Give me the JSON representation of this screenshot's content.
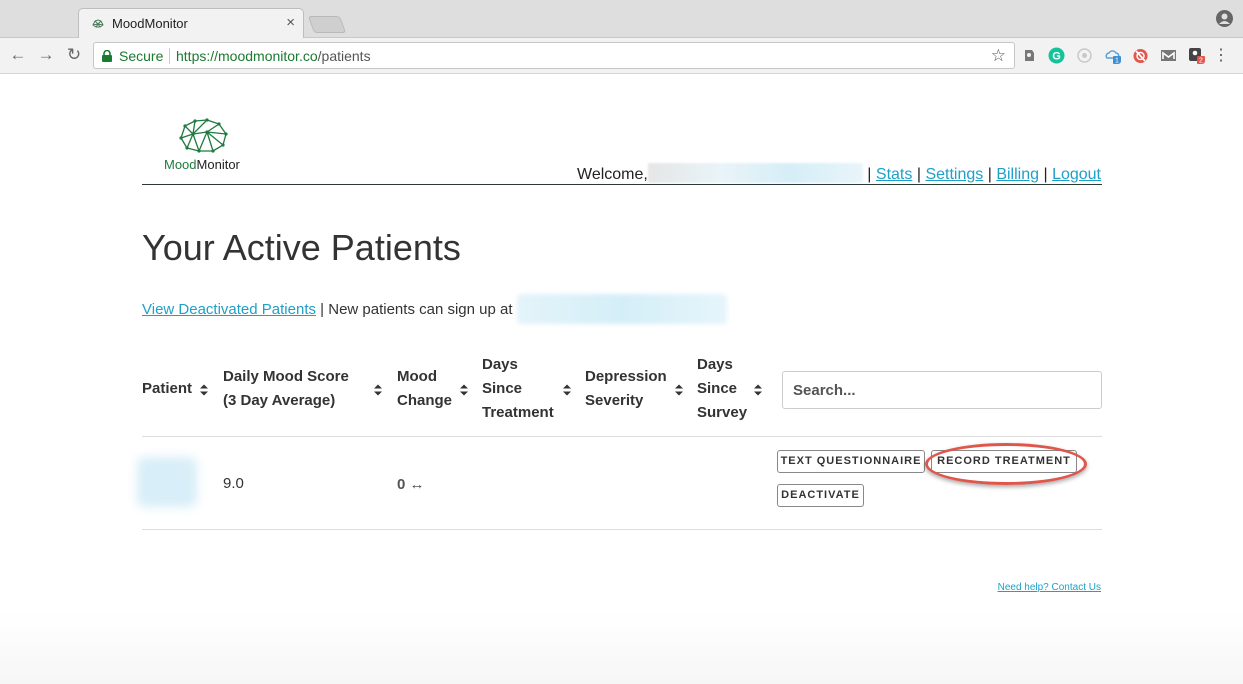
{
  "browser": {
    "tab_title": "MoodMonitor",
    "tab_close": "×",
    "secure_label": "Secure",
    "url_origin": "https://moodmonitor.co",
    "url_path": "/patients",
    "back": "←",
    "forward": "→",
    "reload": "↻",
    "star": "☆",
    "menu": "⋮",
    "extensions": [
      "evernote-icon",
      "grammarly-icon",
      "disabled-extension-icon",
      "cloud-sync-icon",
      "blocker-icon",
      "gmail-icon",
      "profile-switcher-icon"
    ],
    "extension_badges": {
      "cloud": "1",
      "switcher": "2"
    }
  },
  "brand": {
    "name_part1": "Mood",
    "name_part2": "Monitor",
    "color": "#1f7a3f"
  },
  "user_nav": {
    "welcome": "Welcome,",
    "sep": "|",
    "stats": "Stats",
    "settings": "Settings",
    "billing": "Billing",
    "logout": "Logout"
  },
  "page": {
    "title": "Your Active Patients",
    "view_deactivated": "View Deactivated Patients",
    "signup_text": " | New patients can sign up at "
  },
  "table": {
    "headers": {
      "patient": "Patient",
      "daily_mood_l1": "Daily Mood Score",
      "daily_mood_l2": "(3 Day Average)",
      "mood_change_l1": "Mood",
      "mood_change_l2": "Change",
      "days_treatment_l1": "Days",
      "days_treatment_l2": "Since",
      "days_treatment_l3": "Treatment",
      "depression_l1": "Depression",
      "depression_l2": "Severity",
      "days_survey_l1": "Days",
      "days_survey_l2": "Since",
      "days_survey_l3": "Survey"
    },
    "search_placeholder": "Search...",
    "rows": [
      {
        "mood_score": "9.0",
        "mood_change": "0",
        "mood_change_arrow": "↔",
        "actions": {
          "text_questionnaire": "TEXT QUESTIONNAIRE",
          "record_treatment": "RECORD TREATMENT",
          "deactivate": "DEACTIVATE"
        }
      }
    ]
  },
  "footer": {
    "help": "Need help? Contact Us"
  },
  "colors": {
    "link": "#1ea0c8",
    "secure": "#1a7a30",
    "highlight": "#e0564a"
  }
}
